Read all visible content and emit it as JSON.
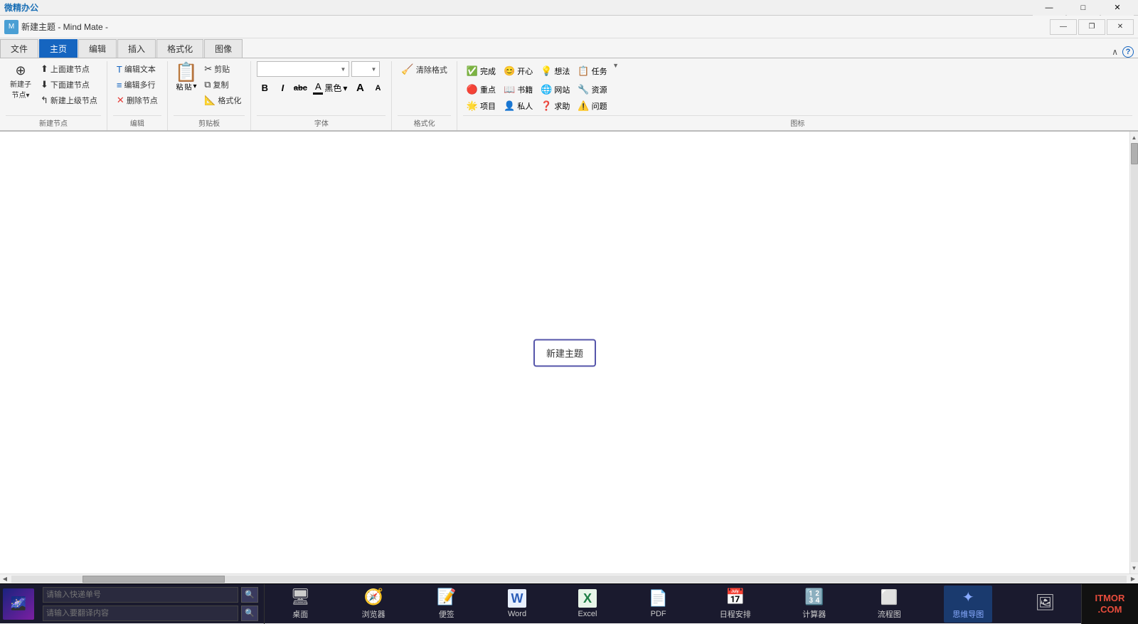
{
  "titlebar": {
    "logo": "微精办公",
    "min": "—",
    "max": "□",
    "close": "✕"
  },
  "app_titlebar": {
    "title": "新建主题 - Mind Mate -",
    "min": "—",
    "restore": "❐",
    "close": "✕"
  },
  "tabs": [
    {
      "label": "文件",
      "active": false
    },
    {
      "label": "主页",
      "active": true
    },
    {
      "label": "编辑",
      "active": false
    },
    {
      "label": "插入",
      "active": false
    },
    {
      "label": "格式化",
      "active": false
    },
    {
      "label": "图像",
      "active": false
    }
  ],
  "ribbon": {
    "new_node": {
      "label": "新建子节点",
      "add_above": "上面建节点",
      "add_below": "下面建节点",
      "add_parent": "新建上级节点",
      "group_label": "新建节点"
    },
    "edit": {
      "edit_text": "编辑文本",
      "edit_multiline": "编辑多行",
      "delete_node": "删除节点",
      "group_label": "编辑"
    },
    "clipboard": {
      "cut": "剪贴",
      "copy": "复制",
      "paste_dropdown": "粘贴",
      "format_paste": "格式化",
      "group_label": "剪贴板"
    },
    "font": {
      "font_name": "",
      "font_size": "",
      "bold": "B",
      "italic": "I",
      "strikethrough": "abc",
      "color_label": "黑色▾",
      "grow": "A",
      "shrink": "A",
      "group_label": "字体"
    },
    "format": {
      "clear_format": "清除格式",
      "group_label": "格式化"
    },
    "icons": {
      "items": [
        {
          "symbol": "✅",
          "label": "完成"
        },
        {
          "symbol": "😊",
          "label": "开心"
        },
        {
          "symbol": "💡",
          "label": "想法"
        },
        {
          "symbol": "📋",
          "label": "任务"
        },
        {
          "symbol": "🔴",
          "label": "重点"
        },
        {
          "symbol": "📖",
          "label": "书籍"
        },
        {
          "symbol": "🌐",
          "label": "网站"
        },
        {
          "symbol": "🔧",
          "label": "资源"
        },
        {
          "symbol": "🌟",
          "label": "项目"
        },
        {
          "symbol": "👤",
          "label": "私人"
        },
        {
          "symbol": "❓",
          "label": "求助"
        },
        {
          "symbol": "⚠️",
          "label": "问题"
        }
      ],
      "group_label": "图标"
    }
  },
  "canvas": {
    "central_node_text": "新建主题"
  },
  "taskbar": {
    "input_placeholder": "请输入快递单号",
    "translate_placeholder": "请输入要翻译内容",
    "apps": [
      {
        "icon": "🖥",
        "label": "桌面"
      },
      {
        "icon": "🧭",
        "label": "浏览器"
      },
      {
        "icon": "📝",
        "label": "便签"
      },
      {
        "icon": "W",
        "label": "Word"
      },
      {
        "icon": "X",
        "label": "Excel"
      },
      {
        "icon": "📄",
        "label": "PDF"
      },
      {
        "icon": "📅",
        "label": "日程安排"
      },
      {
        "icon": "🔢",
        "label": "计算器"
      },
      {
        "icon": "◻",
        "label": "流程图"
      },
      {
        "icon": "✦",
        "label": "思维导图"
      },
      {
        "icon": "🖼",
        "label": ""
      }
    ],
    "logo": "ITMOR\n.COM"
  }
}
